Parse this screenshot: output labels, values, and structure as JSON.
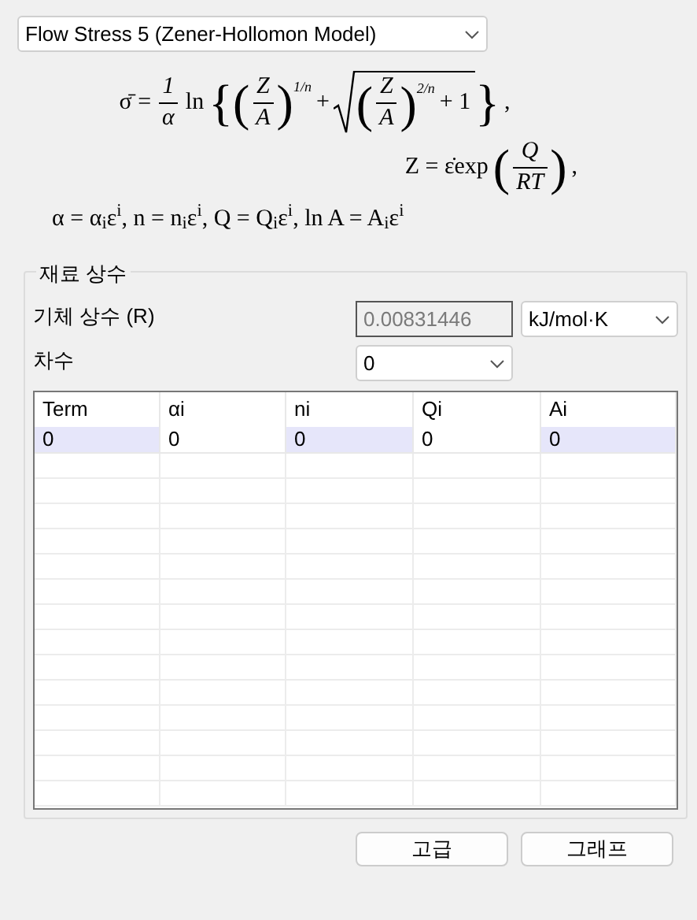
{
  "model_select": {
    "value": "Flow Stress 5 (Zener-Hollomon Model)"
  },
  "equations": [
    {
      "tokens": [
        {
          "kind": "text",
          "text": "σ̄ ="
        },
        {
          "kind": "frac",
          "num": "1",
          "den": "α"
        },
        {
          "kind": "text",
          "text": "ln"
        },
        {
          "kind": "delim",
          "text": "{"
        },
        {
          "kind": "delim",
          "text": "("
        },
        {
          "kind": "frac",
          "num": "Z",
          "den": "A"
        },
        {
          "kind": "delim",
          "text": ")"
        },
        {
          "kind": "sup",
          "text": "1/n"
        },
        {
          "kind": "text",
          "text": "+"
        },
        {
          "kind": "sqrt",
          "tokens": [
            {
              "kind": "delim",
              "text": "("
            },
            {
              "kind": "frac",
              "num": "Z",
              "den": "A"
            },
            {
              "kind": "delim",
              "text": ")"
            },
            {
              "kind": "sup",
              "text": "2/n"
            },
            {
              "kind": "text",
              "text": "+ 1"
            }
          ]
        },
        {
          "kind": "delim",
          "text": "}"
        },
        {
          "kind": "text",
          "text": ","
        }
      ]
    },
    {
      "tokens": [
        {
          "kind": "text",
          "text": "Z = ε̇exp"
        },
        {
          "kind": "delim",
          "text": "("
        },
        {
          "kind": "frac",
          "num": "Q",
          "den": "RT"
        },
        {
          "kind": "delim",
          "text": ")"
        },
        {
          "kind": "text",
          "text": ","
        }
      ]
    },
    {
      "tokens": [
        {
          "kind": "text",
          "text": "α = α$_{i}$ε$^{i}$, n = n$_{i}$ε$^{i}$, Q = Q$_{i}$ε$^{i}$, ln A = A$_{i}$ε$^{i}$"
        }
      ]
    }
  ],
  "group": {
    "title": "재료 상수",
    "gas_constant": {
      "label": "기체 상수 (R)",
      "value": "0.00831446",
      "unit": "kJ/mol·K"
    },
    "order": {
      "label": "차수",
      "value": "0"
    },
    "table": {
      "columns": [
        "Term",
        "αi",
        "ni",
        "Qi",
        "Ai"
      ],
      "rows": [
        {
          "selected": true,
          "cells": [
            "0",
            "0",
            "0",
            "0",
            "0"
          ]
        }
      ]
    }
  },
  "buttons": [
    "고급",
    "그래프"
  ]
}
